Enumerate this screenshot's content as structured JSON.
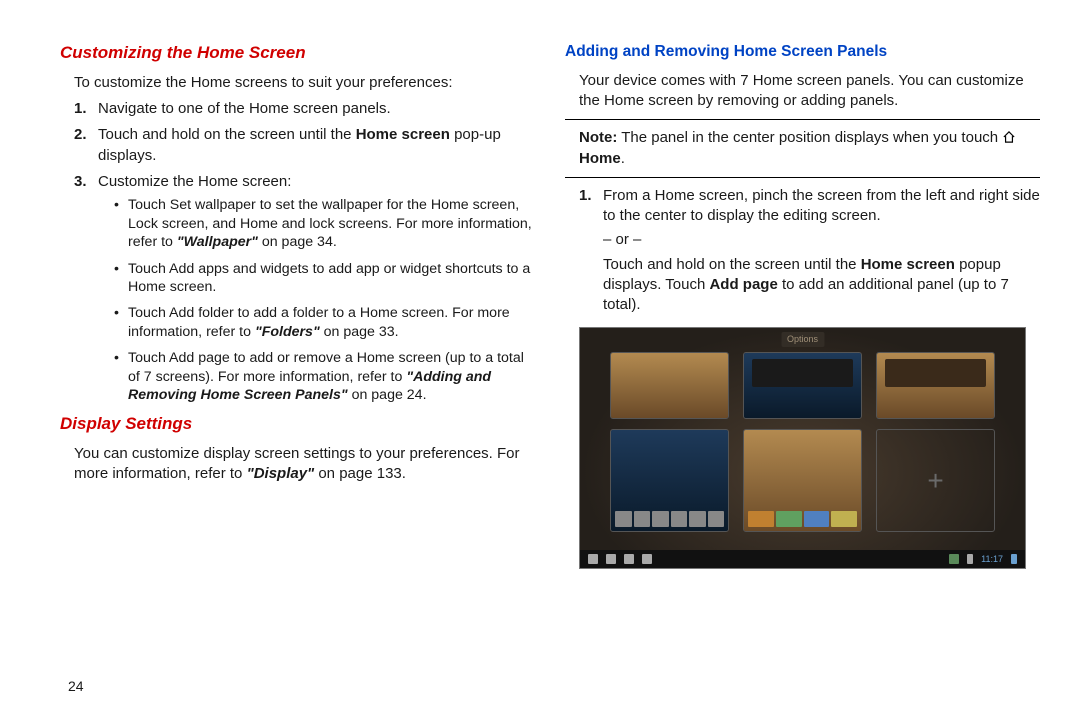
{
  "left": {
    "h1": "Customizing the Home Screen",
    "intro": "To customize the Home screens to suit your preferences:",
    "steps": [
      "Navigate to one of the Home screen panels.",
      "Touch and hold on the screen until the ",
      "Customize the Home screen:"
    ],
    "step2_bold": "Home screen",
    "step2_tail": " pop-up displays.",
    "bullets": {
      "b1a": "Touch Set wallpaper to set the wallpaper for the Home screen, Lock screen, and Home and lock screens. For more information, refer to ",
      "b1ref": "\"Wallpaper\"",
      "b1b": "  on page 34.",
      "b2": "Touch Add apps and widgets to add app or widget shortcuts to a Home screen.",
      "b3a": "Touch Add folder to add a folder to a Home screen. For more information, refer to ",
      "b3ref": "\"Folders\"",
      "b3b": "  on page 33.",
      "b4a": "Touch Add page to add or remove a Home screen (up to a total of 7 screens). For more information, refer to ",
      "b4ref": "\"Adding and Removing Home Screen Panels\"",
      "b4b": "  on page 24."
    },
    "h2": "Display Settings",
    "disp_a": "You can customize display screen settings to your preferences. For more information, refer to ",
    "disp_ref": "\"Display\"",
    "disp_b": "  on page 133."
  },
  "right": {
    "h1": "Adding and Removing Home Screen Panels",
    "intro": "Your device comes with 7 Home screen panels. You can customize the Home screen by removing or adding panels.",
    "note_lead": "Note:",
    "note_body": " The panel in the center position displays when you touch ",
    "note_home": "Home",
    "note_tail": ".",
    "step1a": "From a Home screen, pinch the screen from the left and right side to the center to display the editing screen.",
    "or": "– or –",
    "step1b_a": "Touch and hold on the screen until the ",
    "step1b_bold1": "Home screen",
    "step1b_mid": " popup displays. Touch ",
    "step1b_bold2": "Add page",
    "step1b_tail": " to add an additional panel (up to 7 total)."
  },
  "shot": {
    "top_label": "Options",
    "time": "11:17"
  },
  "page_number": "24"
}
